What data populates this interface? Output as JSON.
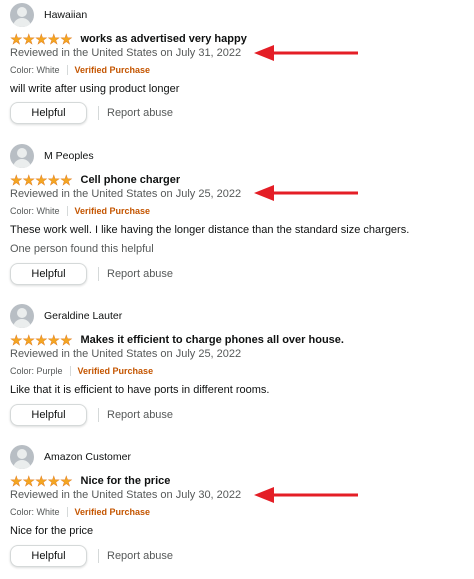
{
  "colors": {
    "star": "#F4A621",
    "verified": "#C45500",
    "arrow": "#E41E26",
    "muted": "#565959"
  },
  "icons": {
    "avatar": "avatar-icon",
    "star": "star-icon",
    "arrow": "red-arrow-icon"
  },
  "reviews": [
    {
      "name": "Hawaiian",
      "rating": 5,
      "title": "works as advertised very happy",
      "date": "Reviewed in the United States on July 31, 2022",
      "color": "Color: White",
      "verified": "Verified Purchase",
      "text": "will write after using product longer",
      "found_helpful": "",
      "helpful_label": "Helpful",
      "report_label": "Report abuse"
    },
    {
      "name": "M Peoples",
      "rating": 5,
      "title": "Cell phone charger",
      "date": "Reviewed in the United States on July 25, 2022",
      "color": "Color: White",
      "verified": "Verified Purchase",
      "text": "These work well. I like having the longer distance than the standard size chargers.",
      "found_helpful": "One person found this helpful",
      "helpful_label": "Helpful",
      "report_label": "Report abuse"
    },
    {
      "name": "Geraldine Lauter",
      "rating": 5,
      "title": "Makes it efficient to charge phones all over house.",
      "date": "Reviewed in the United States on July 25, 2022",
      "color": "Color: Purple",
      "verified": "Verified Purchase",
      "text": "Like that it is efficient to have ports in different rooms.",
      "found_helpful": "",
      "helpful_label": "Helpful",
      "report_label": "Report abuse"
    },
    {
      "name": "Amazon Customer",
      "rating": 5,
      "title": "Nice for the price",
      "date": "Reviewed in the United States on July 30, 2022",
      "color": "Color: White",
      "verified": "Verified Purchase",
      "text": "Nice for the price",
      "found_helpful": "",
      "helpful_label": "Helpful",
      "report_label": "Report abuse"
    }
  ]
}
